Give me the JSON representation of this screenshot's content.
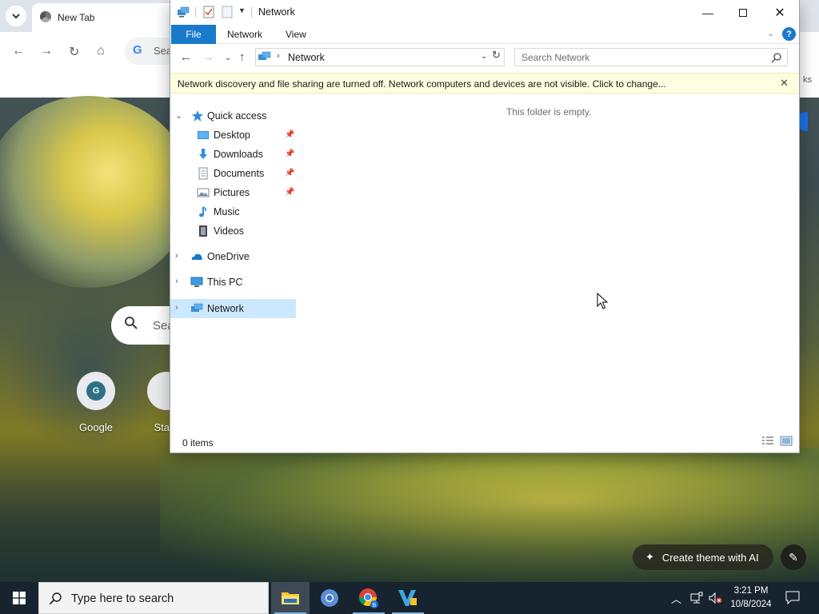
{
  "chrome": {
    "tab_title": "New Tab",
    "omnibox_text": "Sea",
    "bookmarks_hint": "ks",
    "ntp_search_text": "Sea",
    "shortcuts": [
      {
        "label": "Google",
        "letter": "G"
      },
      {
        "label": "Stare",
        "letter": ""
      }
    ],
    "create_theme_label": "Create theme with AI"
  },
  "explorer": {
    "title": "Network",
    "ribbon_tabs": {
      "file": "File",
      "network": "Network",
      "view": "View"
    },
    "address_path": "Network",
    "search_placeholder": "Search Network",
    "infobar_message": "Network discovery and file sharing are turned off. Network computers and devices are not visible. Click to change...",
    "nav_tree": {
      "quick_access": "Quick access",
      "desktop": "Desktop",
      "downloads": "Downloads",
      "documents": "Documents",
      "pictures": "Pictures",
      "music": "Music",
      "videos": "Videos",
      "onedrive": "OneDrive",
      "this_pc": "This PC",
      "network": "Network"
    },
    "empty_message": "This folder is empty.",
    "status_items": "0 items"
  },
  "taskbar": {
    "search_placeholder": "Type here to search",
    "clock_time": "3:21 PM",
    "clock_date": "10/8/2024",
    "chrome_badge": "B"
  },
  "colors": {
    "accent": "#1979ca",
    "selection": "#cce8ff",
    "infobar": "#fffee0",
    "taskbar": "#17232e"
  }
}
